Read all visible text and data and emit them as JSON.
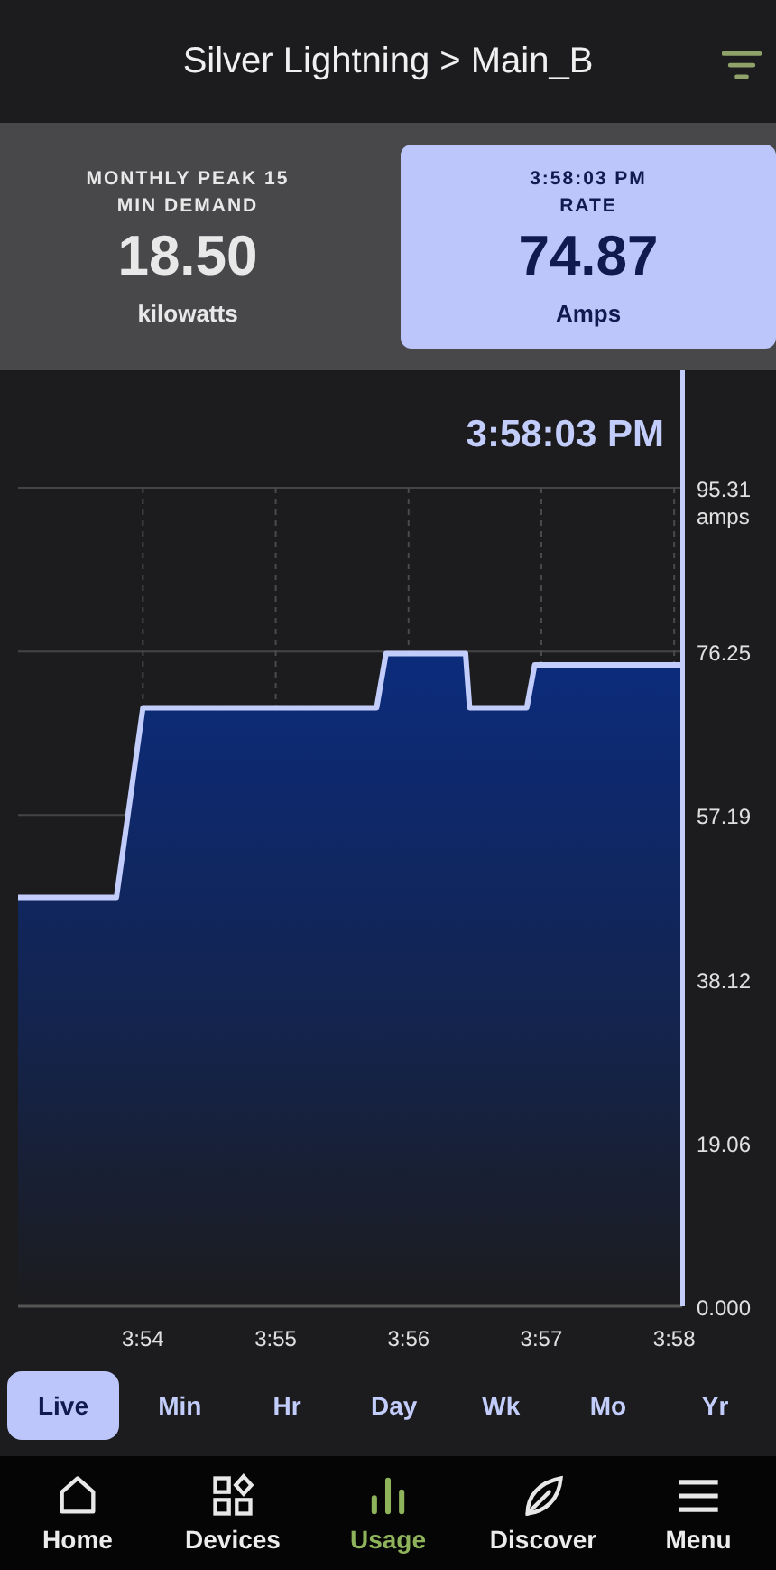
{
  "header": {
    "title": "Silver Lightning > Main_B"
  },
  "cards": [
    {
      "kind": "plain",
      "caption": "MONTHLY PEAK 15 MIN DEMAND",
      "value": "18.50",
      "unit": "kilowatts"
    },
    {
      "kind": "time",
      "time": "3:58:03 PM",
      "caption": "RATE",
      "value": "74.87",
      "unit": "Amps"
    }
  ],
  "chart_timestamp": "3:58:03 PM",
  "chart_data": {
    "type": "area",
    "grid": true,
    "ylabel": "amps",
    "xlim": [
      233.06,
      238.06
    ],
    "ylim": [
      0,
      95.31
    ],
    "xticks": [
      {
        "value": 234,
        "label": "3:54"
      },
      {
        "value": 235,
        "label": "3:55"
      },
      {
        "value": 236,
        "label": "3:56"
      },
      {
        "value": 237,
        "label": "3:57"
      },
      {
        "value": 238,
        "label": "3:58"
      }
    ],
    "yticks": [
      {
        "value": 0,
        "label": "0.000"
      },
      {
        "value": 19.06,
        "label": "19.06"
      },
      {
        "value": 38.12,
        "label": "38.12"
      },
      {
        "value": 57.19,
        "label": "57.19"
      },
      {
        "value": 76.25,
        "label": "76.25"
      },
      {
        "value": 95.31,
        "label": "95.31"
      }
    ],
    "x": [
      233.06,
      233.8,
      234,
      235.76,
      235.83,
      236.43,
      236.46,
      236.89,
      236.95,
      238.06
    ],
    "series": [
      {
        "color": "#c3cdfb",
        "values": [
          47.6,
          47.6,
          69.7,
          69.7,
          76.0,
          76.0,
          69.7,
          69.7,
          74.7,
          74.7
        ]
      }
    ]
  },
  "range_tabs": [
    {
      "label": "Live",
      "selected": true
    },
    {
      "label": "Min",
      "selected": false
    },
    {
      "label": "Hr",
      "selected": false
    },
    {
      "label": "Day",
      "selected": false
    },
    {
      "label": "Wk",
      "selected": false
    },
    {
      "label": "Mo",
      "selected": false
    },
    {
      "label": "Yr",
      "selected": false
    }
  ],
  "nav": [
    {
      "label": "Home",
      "selected": false
    },
    {
      "label": "Devices",
      "selected": false
    },
    {
      "label": "Usage",
      "selected": true
    },
    {
      "label": "Discover",
      "selected": false
    },
    {
      "label": "Menu",
      "selected": false
    }
  ]
}
